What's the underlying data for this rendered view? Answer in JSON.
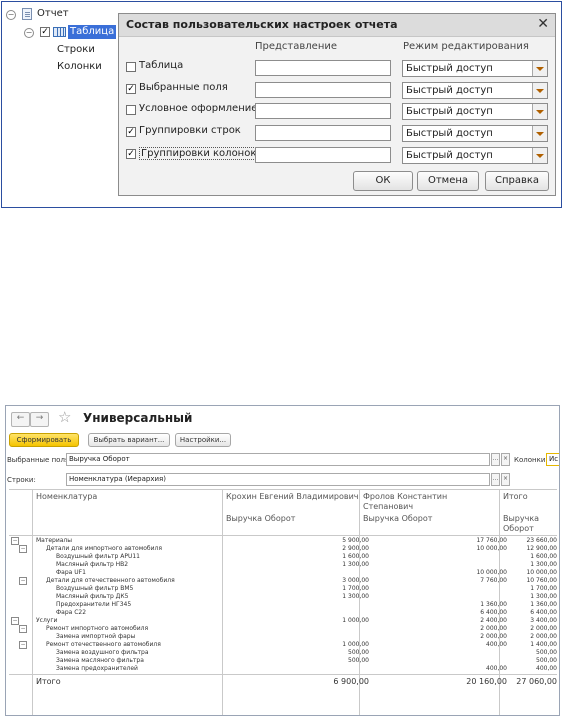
{
  "tree": {
    "root": "Отчет",
    "table": "Таблица",
    "rows": "Строки",
    "columns": "Колонки"
  },
  "dialog": {
    "title": "Состав пользовательских настроек отчета",
    "col_presentation": "Представление",
    "col_mode": "Режим редактирования",
    "options": [
      {
        "label": "Таблица",
        "checked": false,
        "mode": "Быстрый доступ"
      },
      {
        "label": "Выбранные поля",
        "checked": true,
        "mode": "Быстрый доступ"
      },
      {
        "label": "Условное оформление",
        "checked": false,
        "mode": "Быстрый доступ"
      },
      {
        "label": "Группировки строк",
        "checked": true,
        "mode": "Быстрый доступ"
      },
      {
        "label": "Группировки колонок",
        "checked": true,
        "mode": "Быстрый доступ"
      }
    ],
    "ok": "ОК",
    "cancel": "Отмена",
    "help": "Справка"
  },
  "report": {
    "title": "Универсальный",
    "form_button": "Сформировать",
    "choose_variant": "Выбрать вариант...",
    "settings": "Настройки...",
    "selected_fields_label": "Выбранные поля:",
    "selected_fields_value": "Выручка Оборот",
    "columns_label": "Колонки:",
    "columns_value": "Ис",
    "rows_label": "Строки:",
    "rows_value": "Номенклатура (Иерархия)",
    "head": {
      "nom": "Номенклатура",
      "p1": "Крохин Евгений Владимирович",
      "p2_l1": "Фролов Константин",
      "p2_l2": "Степанович",
      "total": "Итого",
      "m1": "Выручка Оборот",
      "m2": "Выручка Оборот",
      "m3_l1": "Выручка",
      "m3_l2": "Оборот"
    },
    "rows": [
      {
        "name": "Материалы",
        "v1": "5 900,00",
        "v2": "17 760,00",
        "v3": "23 660,00"
      },
      {
        "name": "Детали для импортного автомобиля",
        "v1": "2 900,00",
        "v2": "10 000,00",
        "v3": "12 900,00"
      },
      {
        "name": "Воздушный фильтр APU11",
        "v1": "1 600,00",
        "v2": "",
        "v3": "1 600,00"
      },
      {
        "name": "Масляный фильтр HB2",
        "v1": "1 300,00",
        "v2": "",
        "v3": "1 300,00"
      },
      {
        "name": "Фара UF1",
        "v1": "",
        "v2": "10 000,00",
        "v3": "10 000,00"
      },
      {
        "name": "Детали для отечественного автомобиля",
        "v1": "3 000,00",
        "v2": "7 760,00",
        "v3": "10 760,00"
      },
      {
        "name": "Воздушный фильтр ВМ5",
        "v1": "1 700,00",
        "v2": "",
        "v3": "1 700,00"
      },
      {
        "name": "Масляный фильтр ДК5",
        "v1": "1 300,00",
        "v2": "",
        "v3": "1 300,00"
      },
      {
        "name": "Предохранители НГ345",
        "v1": "",
        "v2": "1 360,00",
        "v3": "1 360,00"
      },
      {
        "name": "Фара С22",
        "v1": "",
        "v2": "6 400,00",
        "v3": "6 400,00"
      },
      {
        "name": "Услуги",
        "v1": "1 000,00",
        "v2": "2 400,00",
        "v3": "3 400,00"
      },
      {
        "name": "Ремонт импортного автомобиля",
        "v1": "",
        "v2": "2 000,00",
        "v3": "2 000,00"
      },
      {
        "name": "Замена импортной фары",
        "v1": "",
        "v2": "2 000,00",
        "v3": "2 000,00"
      },
      {
        "name": "Ремонт отечественного автомобиля",
        "v1": "1 000,00",
        "v2": "400,00",
        "v3": "1 400,00"
      },
      {
        "name": "Замена воздушного фильтра",
        "v1": "500,00",
        "v2": "",
        "v3": "500,00"
      },
      {
        "name": "Замена масляного фильтра",
        "v1": "500,00",
        "v2": "",
        "v3": "500,00"
      },
      {
        "name": "Замена предохранителей",
        "v1": "",
        "v2": "400,00",
        "v3": "400,00"
      }
    ],
    "total": {
      "name": "Итого",
      "v1": "6 900,00",
      "v2": "20 160,00",
      "v3": "27 060,00"
    }
  },
  "colors": {
    "accent": "#f5c400",
    "frame": "#2b4ea0",
    "selection": "#3a6fd8"
  }
}
